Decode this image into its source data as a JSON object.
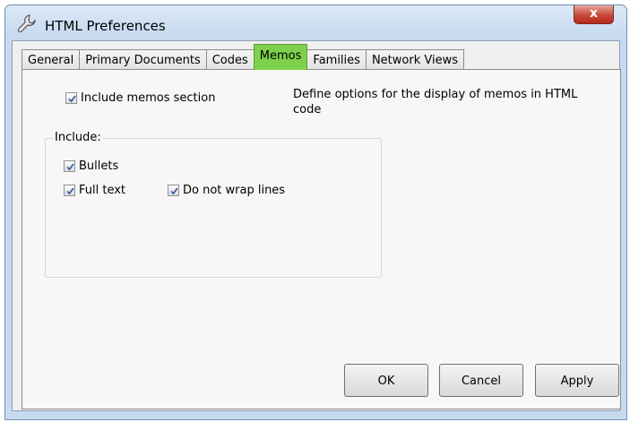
{
  "window": {
    "title": "HTML Preferences",
    "close_label": "x"
  },
  "tabs": [
    {
      "label": "General",
      "active": false
    },
    {
      "label": "Primary Documents",
      "active": false
    },
    {
      "label": "Codes",
      "active": false
    },
    {
      "label": "Memos",
      "active": true
    },
    {
      "label": "Families",
      "active": false
    },
    {
      "label": "Network Views",
      "active": false
    }
  ],
  "memos": {
    "include_section": {
      "label": "Include memos section",
      "checked": true
    },
    "description": "Define options for the display of memos in HTML code",
    "include_group": {
      "legend": "Include:",
      "bullets": {
        "label": "Bullets",
        "checked": true
      },
      "full_text": {
        "label": "Full text",
        "checked": true
      },
      "no_wrap": {
        "label": "Do not wrap lines",
        "checked": true
      }
    }
  },
  "buttons": {
    "ok": "OK",
    "cancel": "Cancel",
    "apply": "Apply"
  },
  "colors": {
    "active_tab": "#7ed14d",
    "close_button": "#c8483a"
  }
}
